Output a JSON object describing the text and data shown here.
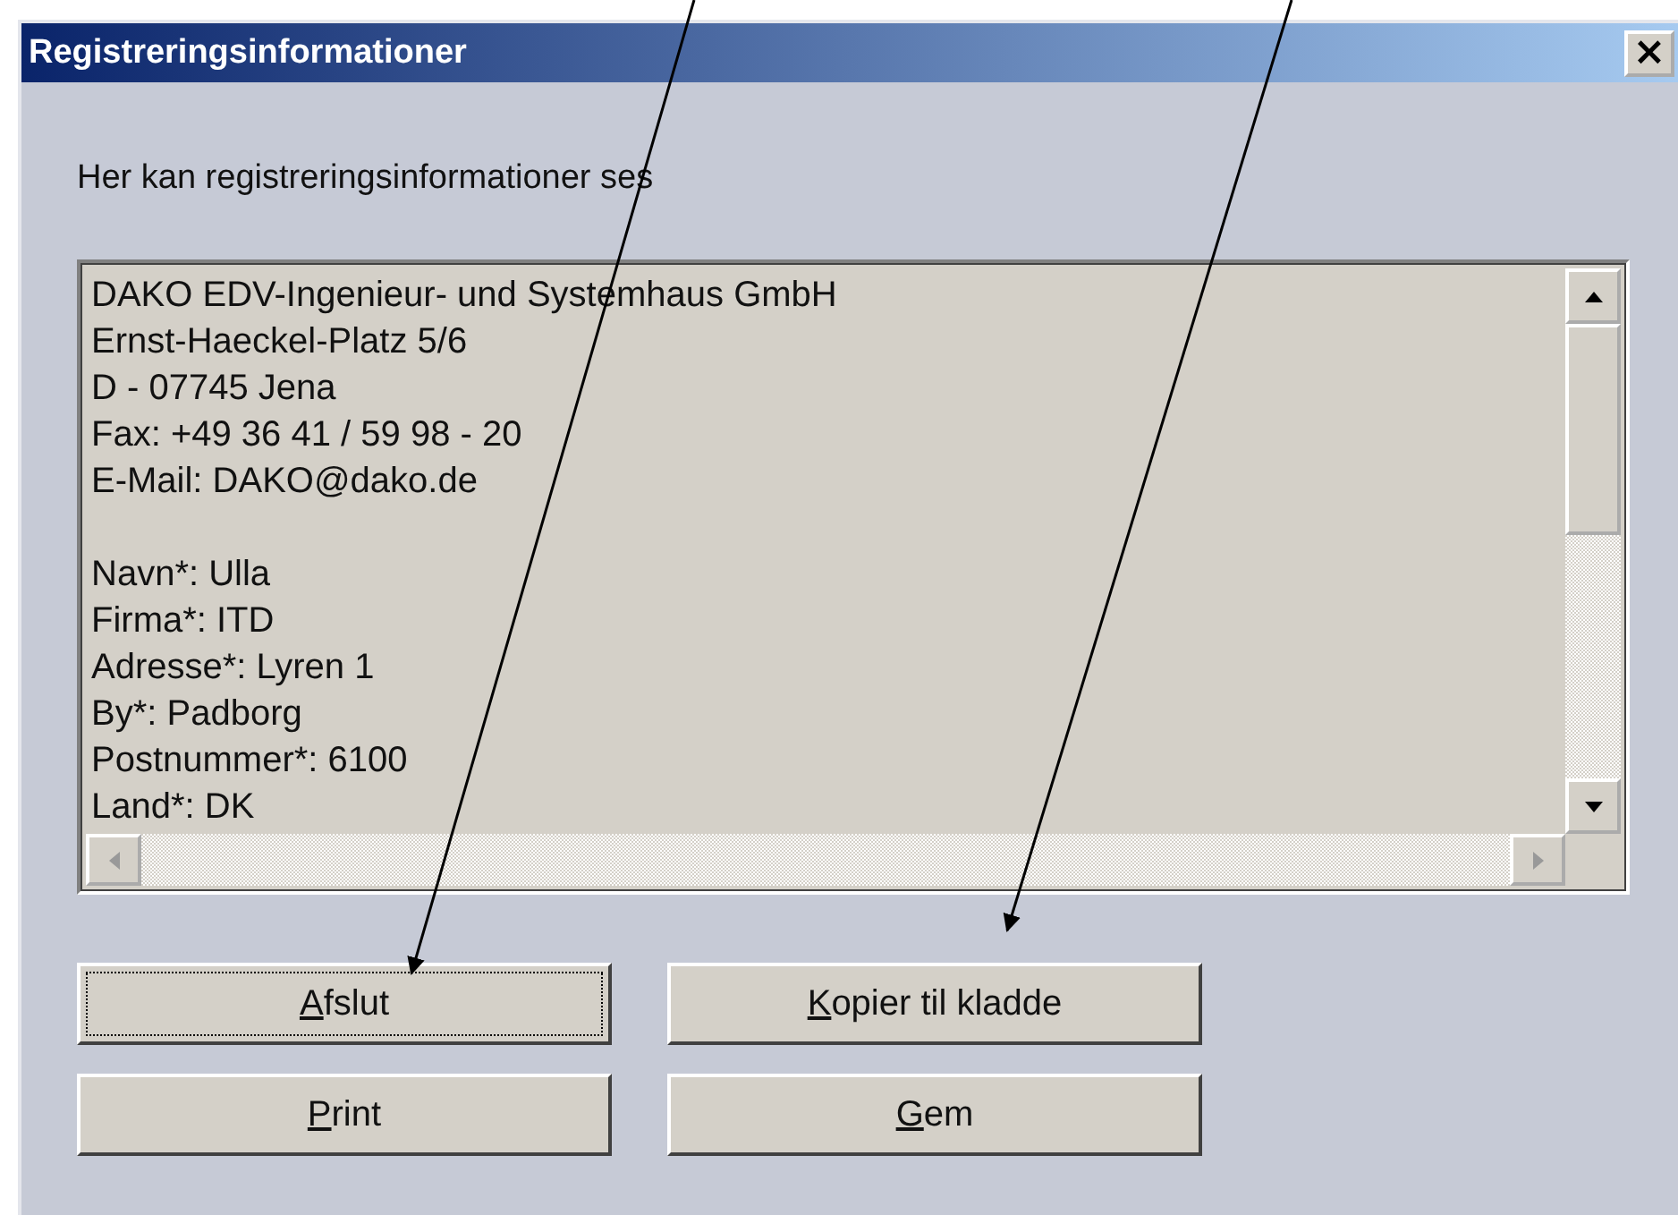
{
  "window": {
    "title": "Registreringsinformationer",
    "close_icon": "×"
  },
  "intro": "Her kan registreringsinformationer ses",
  "info_blocks": [
    [
      "DAKO EDV-Ingenieur- und Systemhaus GmbH",
      "Ernst-Haeckel-Platz 5/6",
      "D - 07745 Jena",
      "Fax: +49 36 41 / 59 98 - 20",
      "E-Mail: DAKO@dako.de"
    ],
    [
      "Navn*: Ulla",
      "Firma*: ITD",
      "Adresse*: Lyren 1",
      "By*: Padborg",
      "Postnummer*: 6100",
      "Land*: DK"
    ]
  ],
  "buttons": [
    {
      "label": "Afslut",
      "focused": true
    },
    {
      "label": "Kopier til kladde",
      "focused": false
    },
    {
      "label": "Print",
      "focused": false
    },
    {
      "label": "Gem",
      "focused": false
    }
  ]
}
